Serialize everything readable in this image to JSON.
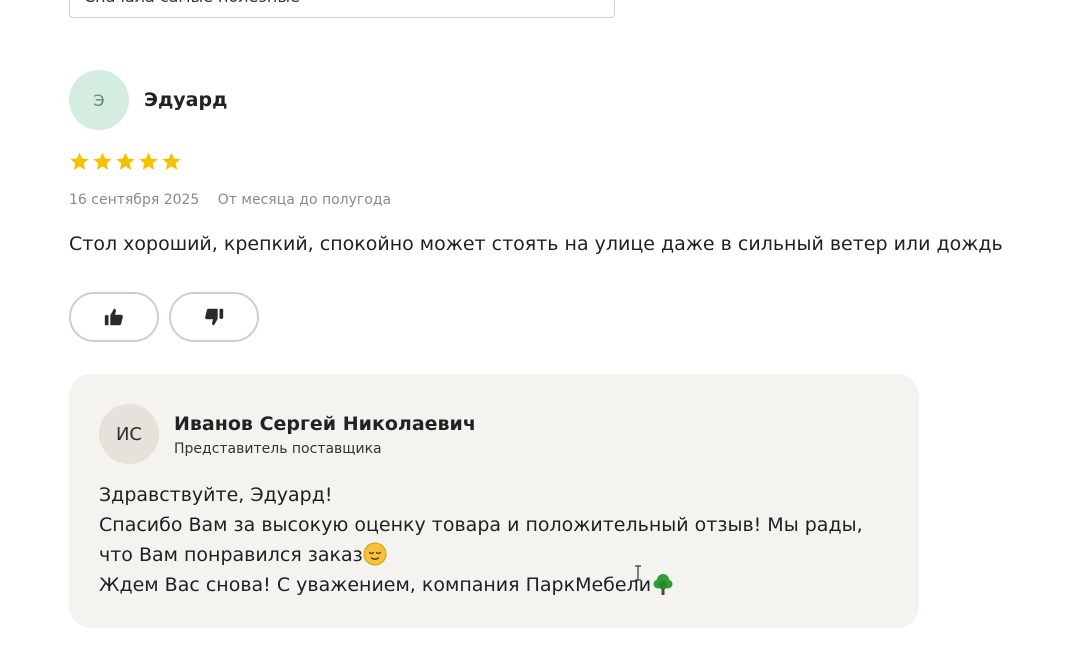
{
  "sort": {
    "selected": "Сначала самые полезные"
  },
  "review": {
    "avatar_initial": "Э",
    "author": "Эдуард",
    "rating": 5,
    "rating_max": 5,
    "date": "16 сентября 2025",
    "usage_period": "От месяца до полугода",
    "text": "Стол хороший, крепкий, спокойно может стоять на улице даже в сильный ветер или дождь",
    "colors": {
      "star": "#f6c000",
      "avatar_bg": "#d5ece1"
    }
  },
  "votes": {
    "like_icon": "thumbs-up-icon",
    "dislike_icon": "thumbs-down-icon"
  },
  "reply": {
    "avatar_initials": "ИС",
    "name": "Иванов Сергей Николаевич",
    "role": "Представитель поставщика",
    "lines": [
      "Здравствуйте, Эдуард!",
      "Спасибо Вам за высокую оценку товара и положительный отзыв! Мы рады,",
      "что Вам понравился заказ",
      "Ждем Вас снова! С уважением, компания ПаркМебели"
    ],
    "emoji_after_line_3": "relieved-face-icon",
    "emoji_after_line_4": "tree-icon"
  }
}
